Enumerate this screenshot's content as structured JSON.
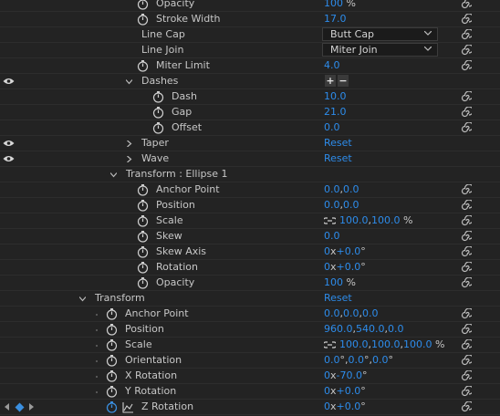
{
  "rows": [
    {
      "name": "Opacity",
      "value": "100",
      "unit": "%"
    },
    {
      "name": "Stroke Width",
      "value": "17.0"
    },
    {
      "name": "Line Cap",
      "select": "Butt Cap"
    },
    {
      "name": "Line Join",
      "select": "Miter Join"
    },
    {
      "name": "Miter Limit",
      "value": "4.0"
    },
    {
      "name": "Dashes",
      "plus": "+",
      "minus": "−"
    },
    {
      "name": "Dash",
      "value": "10.0"
    },
    {
      "name": "Gap",
      "value": "21.0"
    },
    {
      "name": "Offset",
      "value": "0.0"
    },
    {
      "name": "Taper",
      "value": "Reset"
    },
    {
      "name": "Wave",
      "value": "Reset"
    },
    {
      "name": "Transform : Ellipse 1"
    },
    {
      "name": "Anchor Point",
      "v1": "0.0",
      "v2": "0.0"
    },
    {
      "name": "Position",
      "v1": "0.0",
      "v2": "0.0"
    },
    {
      "name": "Scale",
      "v1": "100.0",
      "v2": "100.0",
      "unit": "%"
    },
    {
      "name": "Skew",
      "value": "0.0"
    },
    {
      "name": "Skew Axis",
      "a": "0",
      "b": "+0.0",
      "deg": "°"
    },
    {
      "name": "Rotation",
      "a": "0",
      "b": "+0.0",
      "deg": "°"
    },
    {
      "name": "Opacity",
      "value": "100",
      "unit": "%"
    },
    {
      "name": "Transform",
      "value": "Reset"
    },
    {
      "name": "Anchor Point",
      "v1": "0.0",
      "v2": "0.0",
      "v3": "0.0"
    },
    {
      "name": "Position",
      "v1": "960.0",
      "v2": "540.0",
      "v3": "0.0"
    },
    {
      "name": "Scale",
      "v1": "100.0",
      "v2": "100.0",
      "v3": "100.0",
      "unit": "%"
    },
    {
      "name": "Orientation",
      "v1": "0.0",
      "v2": "0.0",
      "v3": "0.0",
      "deg": "°"
    },
    {
      "name": "X Rotation",
      "a": "0",
      "b": "-70.0",
      "deg": "°"
    },
    {
      "name": "Y Rotation",
      "a": "0",
      "b": "+0.0",
      "deg": "°"
    },
    {
      "name": "Z Rotation",
      "a": "0",
      "b": "+0.0",
      "deg": "°"
    }
  ],
  "symbols": {
    "times": "x",
    "comma": ","
  },
  "colors": {
    "value": "#2d8ceb",
    "keyframe": "#3a8fe0",
    "bg": "#232323"
  }
}
